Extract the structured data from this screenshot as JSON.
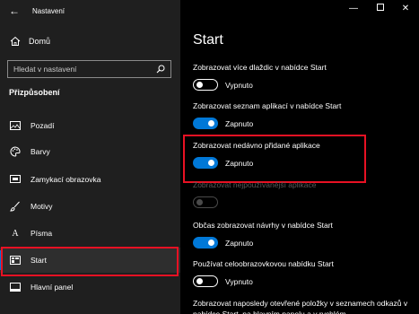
{
  "window": {
    "title": "Nastavení",
    "controls": [
      "minimize-icon",
      "maximize-icon",
      "close-icon"
    ]
  },
  "sidebar": {
    "home_label": "Domů",
    "search_placeholder": "Hledat v nastavení",
    "section_title": "Přizpůsobení",
    "items": [
      {
        "label": "Pozadí",
        "icon": "picture-icon"
      },
      {
        "label": "Barvy",
        "icon": "palette-icon"
      },
      {
        "label": "Zamykací obrazovka",
        "icon": "lock-screen-icon"
      },
      {
        "label": "Motivy",
        "icon": "brush-icon"
      },
      {
        "label": "Písma",
        "icon": "font-icon"
      },
      {
        "label": "Start",
        "icon": "start-menu-icon",
        "active": true
      },
      {
        "label": "Hlavní panel",
        "icon": "taskbar-icon"
      }
    ]
  },
  "main": {
    "title": "Start",
    "settings": [
      {
        "label": "Zobrazovat více dlaždic v nabídce Start",
        "state": "Vypnuto",
        "on": false
      },
      {
        "label": "Zobrazovat seznam aplikací v nabídce Start",
        "state": "Zapnuto",
        "on": true
      },
      {
        "label": "Zobrazovat nedávno přidané aplikace",
        "state": "Zapnuto",
        "on": true
      },
      {
        "label": "Zobrazovat nejpoužívanější aplikace",
        "state": "",
        "on": false,
        "disabled": true
      },
      {
        "label": "Občas zobrazovat návrhy v nabídce Start",
        "state": "Zapnuto",
        "on": true
      },
      {
        "label": "Používat celoobrazovkovou nabídku Start",
        "state": "Vypnuto",
        "on": false
      }
    ],
    "description": "Zobrazovat naposledy otevřené položky v seznamech odkazů v nabídce Start, na hlavním panelu a v rychlém"
  },
  "colors": {
    "accent": "#0078d7",
    "highlight": "#e81123",
    "sidebar_bg": "#1f1f1f",
    "main_bg": "#000000"
  }
}
